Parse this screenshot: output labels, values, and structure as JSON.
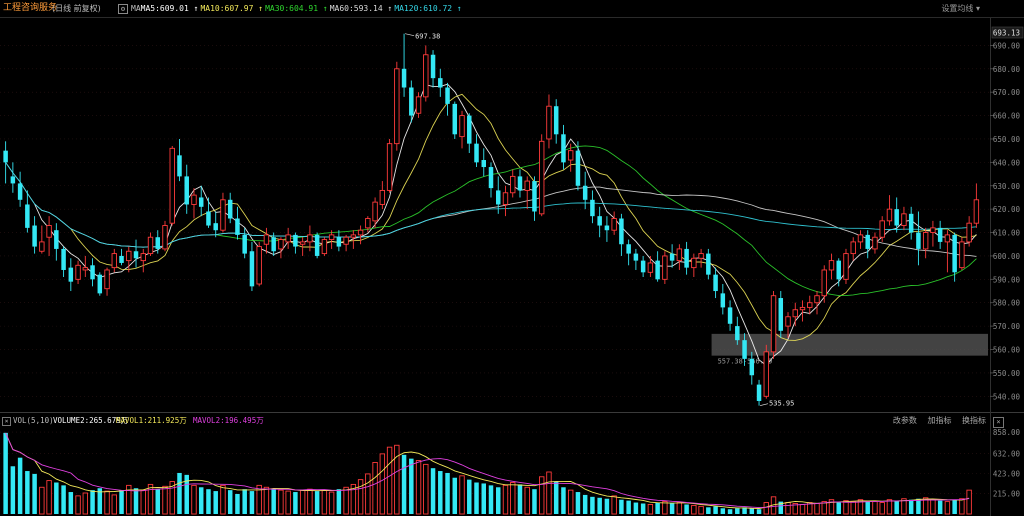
{
  "header": {
    "stock_name": "工程咨询服务",
    "mode": "(日线 前复权)",
    "ma_prefix": "MA",
    "ma_values": [
      {
        "label": "MA5:609.01",
        "color": "#ffffff"
      },
      {
        "label": "MA10:607.97",
        "color": "#f2e85a"
      },
      {
        "label": "MA30:604.91",
        "color": "#2fd62f"
      },
      {
        "label": "MA60:593.14",
        "color": "#d9d9d9"
      },
      {
        "label": "MA120:610.72",
        "color": "#34d6e6"
      }
    ],
    "settings_label": "设置均线"
  },
  "volume_header": {
    "title": "VOL(5,10)",
    "volume": "VOLUME2:265.679万",
    "mavol1": "MAVOL1:211.925万",
    "mavol2": "MAVOL2:196.495万",
    "colors": {
      "volume": "#ffffff",
      "mavol1": "#f2e85a",
      "mavol2": "#e040e0"
    },
    "buttons": [
      "改参数",
      "加指标",
      "换指标"
    ]
  },
  "price_axis": {
    "current_price": "693.13",
    "ticks": [
      "690.00",
      "680.00",
      "670.00",
      "660.00",
      "650.00",
      "640.00",
      "630.00",
      "620.00",
      "610.00",
      "600.00",
      "590.00",
      "580.00",
      "570.00",
      "560.00",
      "550.00",
      "540.00"
    ]
  },
  "volume_axis": {
    "ticks": [
      "858.00",
      "632.00",
      "423.00",
      "215.00"
    ]
  },
  "annotations": {
    "high": "697.38",
    "low": "535.95",
    "gap": "557.38-566.69"
  },
  "chart_data": {
    "type": "candlestick",
    "ylim": [
      535,
      700
    ],
    "volume_ylim": [
      0,
      880
    ],
    "high_label": "697.38",
    "low_label": "535.95",
    "gap_range": [
      557.38,
      566.69
    ],
    "ohlc": [
      [
        645,
        649,
        631,
        640
      ],
      [
        634,
        640,
        627,
        631
      ],
      [
        631,
        636,
        621,
        624
      ],
      [
        622,
        628,
        610,
        612
      ],
      [
        613,
        617,
        601,
        604
      ],
      [
        602,
        613,
        601,
        606
      ],
      [
        608,
        617,
        600,
        613
      ],
      [
        611,
        614,
        598,
        603
      ],
      [
        603,
        604,
        591,
        594
      ],
      [
        595,
        599,
        585,
        589
      ],
      [
        590,
        598,
        588,
        596
      ],
      [
        594,
        600,
        591,
        595
      ],
      [
        596,
        599,
        587,
        590
      ],
      [
        592,
        593,
        583,
        584
      ],
      [
        586,
        595,
        583,
        594
      ],
      [
        595,
        603,
        593,
        601
      ],
      [
        600,
        603,
        596,
        597
      ],
      [
        598,
        604,
        593,
        602
      ],
      [
        602,
        607,
        595,
        599
      ],
      [
        598,
        603,
        593,
        601
      ],
      [
        601,
        610,
        600,
        608
      ],
      [
        608,
        611,
        601,
        603
      ],
      [
        603,
        615,
        602,
        613
      ],
      [
        614,
        647,
        613,
        646
      ],
      [
        643,
        650,
        632,
        634
      ],
      [
        634,
        639,
        618,
        622
      ],
      [
        622,
        629,
        616,
        626
      ],
      [
        625,
        630,
        617,
        621
      ],
      [
        619,
        625,
        612,
        613
      ],
      [
        614,
        619,
        608,
        611
      ],
      [
        611,
        627,
        610,
        624
      ],
      [
        624,
        627,
        614,
        616
      ],
      [
        616,
        621,
        607,
        609
      ],
      [
        609,
        612,
        599,
        601
      ],
      [
        602,
        606,
        585,
        587
      ],
      [
        588,
        606,
        587,
        604
      ],
      [
        605,
        612,
        601,
        609
      ],
      [
        608,
        610,
        600,
        602
      ],
      [
        603,
        608,
        599,
        607
      ],
      [
        606,
        612,
        603,
        609
      ],
      [
        609,
        610,
        601,
        604
      ],
      [
        605,
        608,
        600,
        606
      ],
      [
        606,
        613,
        602,
        609
      ],
      [
        609,
        610,
        599,
        600
      ],
      [
        601,
        608,
        600,
        607
      ],
      [
        607,
        611,
        603,
        609
      ],
      [
        608,
        611,
        602,
        604
      ],
      [
        605,
        609,
        602,
        608
      ],
      [
        608,
        611,
        603,
        609
      ],
      [
        609,
        613,
        605,
        611
      ],
      [
        612,
        617,
        610,
        616
      ],
      [
        615,
        625,
        612,
        623
      ],
      [
        622,
        632,
        620,
        628
      ],
      [
        628,
        650,
        627,
        648
      ],
      [
        648,
        683,
        645,
        680
      ],
      [
        680,
        695,
        668,
        672
      ],
      [
        672,
        675,
        657,
        660
      ],
      [
        661,
        670,
        659,
        668
      ],
      [
        668,
        690,
        666,
        686
      ],
      [
        686,
        688,
        672,
        676
      ],
      [
        676,
        680,
        668,
        672
      ],
      [
        672,
        674,
        660,
        665
      ],
      [
        665,
        666,
        650,
        652
      ],
      [
        651,
        662,
        646,
        660
      ],
      [
        660,
        661,
        644,
        648
      ],
      [
        648,
        652,
        638,
        640
      ],
      [
        641,
        646,
        634,
        638
      ],
      [
        638,
        640,
        625,
        629
      ],
      [
        628,
        634,
        618,
        622
      ],
      [
        622,
        630,
        617,
        627
      ],
      [
        627,
        637,
        625,
        634
      ],
      [
        634,
        637,
        625,
        628
      ],
      [
        628,
        634,
        620,
        632
      ],
      [
        632,
        634,
        615,
        619
      ],
      [
        618,
        652,
        617,
        649
      ],
      [
        650,
        669,
        646,
        664
      ],
      [
        664,
        667,
        648,
        652
      ],
      [
        652,
        656,
        637,
        640
      ],
      [
        641,
        648,
        636,
        645
      ],
      [
        645,
        649,
        628,
        630
      ],
      [
        630,
        636,
        620,
        624
      ],
      [
        624,
        628,
        614,
        617
      ],
      [
        617,
        621,
        608,
        613
      ],
      [
        613,
        617,
        606,
        611
      ],
      [
        611,
        619,
        609,
        616
      ],
      [
        616,
        618,
        600,
        605
      ],
      [
        605,
        607,
        596,
        601
      ],
      [
        601,
        603,
        594,
        598
      ],
      [
        598,
        600,
        591,
        593
      ],
      [
        593,
        600,
        591,
        597
      ],
      [
        598,
        602,
        589,
        590
      ],
      [
        590,
        602,
        588,
        600
      ],
      [
        601,
        605,
        595,
        598
      ],
      [
        598,
        605,
        594,
        603
      ],
      [
        603,
        606,
        592,
        595
      ],
      [
        595,
        601,
        591,
        599
      ],
      [
        599,
        603,
        595,
        601
      ],
      [
        601,
        603,
        590,
        592
      ],
      [
        592,
        595,
        582,
        585
      ],
      [
        584,
        588,
        575,
        578
      ],
      [
        578,
        581,
        568,
        571
      ],
      [
        570,
        574,
        562,
        564
      ],
      [
        564,
        567,
        553,
        556
      ],
      [
        556,
        559,
        545,
        549
      ],
      [
        545,
        547,
        536,
        538
      ],
      [
        540,
        562,
        539,
        559
      ],
      [
        559,
        585,
        556,
        583
      ],
      [
        582,
        585,
        565,
        568
      ],
      [
        570,
        576,
        565,
        574
      ],
      [
        574,
        580,
        570,
        577
      ],
      [
        577,
        581,
        572,
        578
      ],
      [
        578,
        583,
        575,
        580
      ],
      [
        580,
        585,
        575,
        583
      ],
      [
        583,
        596,
        580,
        594
      ],
      [
        594,
        601,
        590,
        598
      ],
      [
        598,
        599,
        587,
        590
      ],
      [
        590,
        603,
        588,
        601
      ],
      [
        601,
        608,
        598,
        606
      ],
      [
        606,
        611,
        603,
        609
      ],
      [
        609,
        611,
        599,
        603
      ],
      [
        603,
        610,
        601,
        608
      ],
      [
        608,
        617,
        606,
        615
      ],
      [
        615,
        626,
        613,
        620
      ],
      [
        620,
        625,
        610,
        613
      ],
      [
        613,
        621,
        611,
        618
      ],
      [
        618,
        621,
        607,
        610
      ],
      [
        610,
        619,
        596,
        603
      ],
      [
        603,
        612,
        599,
        610
      ],
      [
        610,
        615,
        604,
        612
      ],
      [
        612,
        615,
        603,
        606
      ],
      [
        606,
        611,
        593,
        609
      ],
      [
        609,
        610,
        589,
        593
      ],
      [
        595,
        608,
        594,
        606
      ],
      [
        606,
        617,
        604,
        614
      ],
      [
        614,
        631,
        612,
        624
      ]
    ],
    "volume": [
      850,
      500,
      590,
      450,
      420,
      280,
      350,
      330,
      300,
      230,
      190,
      220,
      250,
      270,
      240,
      200,
      250,
      300,
      270,
      250,
      310,
      260,
      290,
      340,
      430,
      410,
      300,
      280,
      260,
      240,
      300,
      250,
      210,
      260,
      240,
      300,
      280,
      260,
      250,
      240,
      230,
      250,
      260,
      240,
      250,
      230,
      260,
      280,
      310,
      360,
      420,
      540,
      630,
      700,
      720,
      620,
      580,
      560,
      520,
      480,
      450,
      430,
      380,
      400,
      360,
      330,
      320,
      300,
      280,
      300,
      330,
      310,
      280,
      260,
      390,
      440,
      340,
      280,
      250,
      230,
      200,
      180,
      170,
      160,
      190,
      150,
      140,
      120,
      110,
      100,
      120,
      130,
      110,
      120,
      100,
      90,
      80,
      70,
      80,
      60,
      50,
      60,
      70,
      60,
      50,
      120,
      180,
      130,
      120,
      110,
      100,
      120,
      110,
      130,
      150,
      120,
      140,
      130,
      150,
      140,
      130,
      120,
      150,
      140,
      160,
      150,
      160,
      170,
      150,
      140,
      130,
      150,
      160,
      250
    ],
    "ma_series": [
      {
        "name": "MA5",
        "period": 5,
        "color": "#ffffff"
      },
      {
        "name": "MA10",
        "period": 10,
        "color": "#f2e85a"
      },
      {
        "name": "MA30",
        "period": 30,
        "color": "#2fd62f"
      },
      {
        "name": "MA60",
        "period": 60,
        "color": "#d9d9d9"
      },
      {
        "name": "MA120",
        "period": 120,
        "color": "#34d6e6"
      }
    ],
    "up_color": "#ff3b3b",
    "down_color": "#34e8f5",
    "vol_ma": [
      {
        "name": "MAVOL1",
        "period": 5,
        "color": "#f2e85a"
      },
      {
        "name": "MAVOL2",
        "period": 10,
        "color": "#e040e0"
      }
    ]
  }
}
